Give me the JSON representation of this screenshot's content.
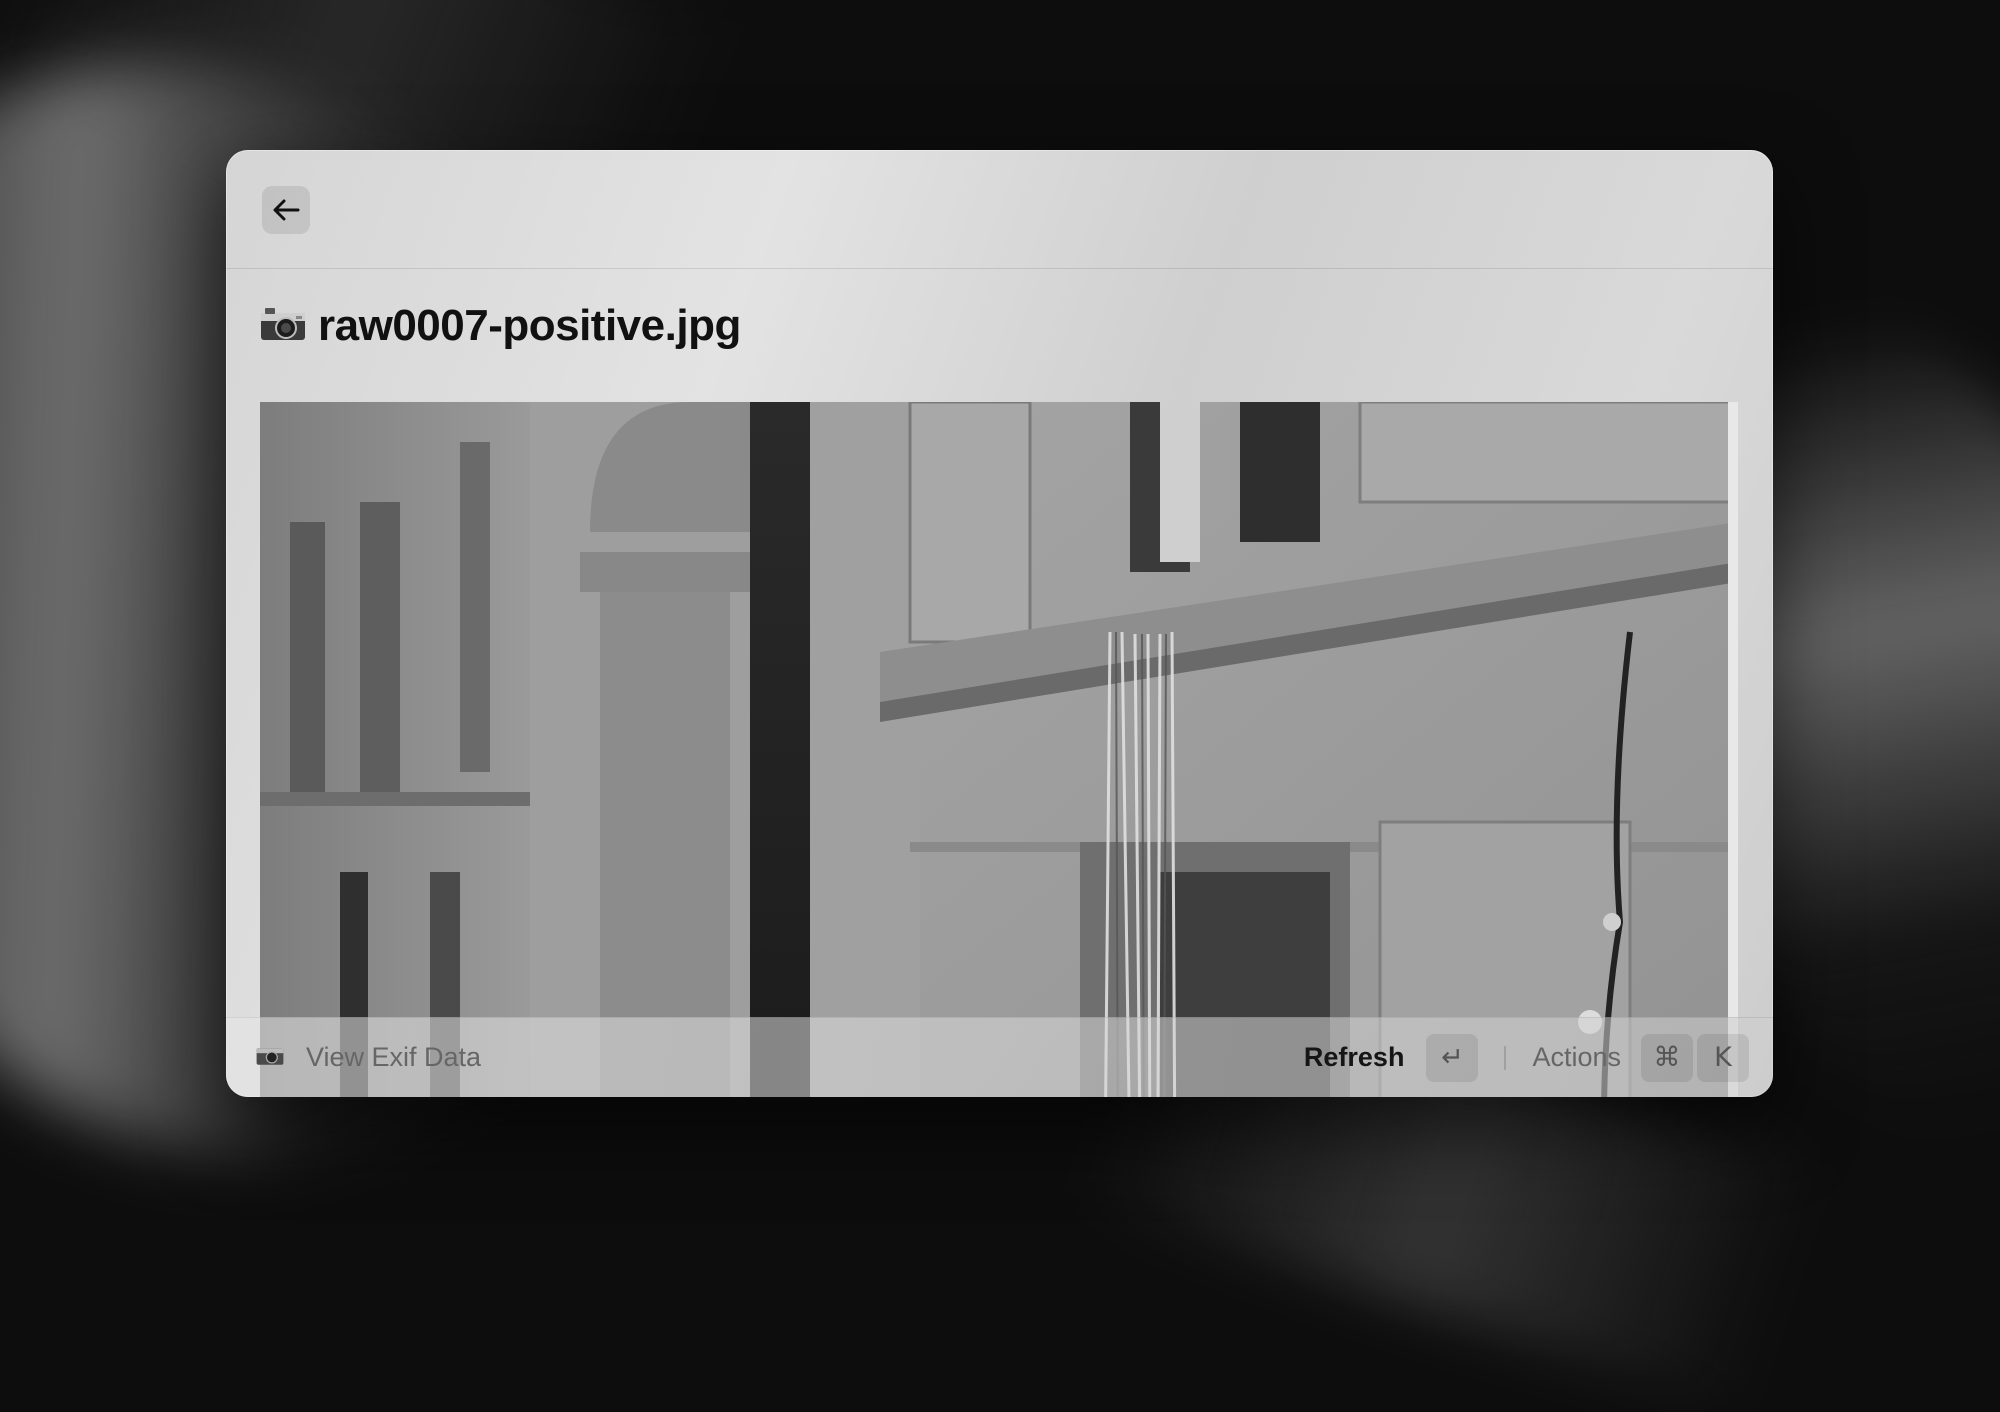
{
  "window": {
    "back_button_label": "←",
    "title_icon": "camera-icon",
    "title": "raw0007-positive.jpg"
  },
  "preview": {
    "image_description_icon": "photo-preview"
  },
  "action_bar": {
    "action_icon": "camera-icon",
    "action_label": "View Exif Data",
    "primary_action_label": "Refresh",
    "primary_shortcut_key": "↵",
    "secondary_action_label": "Actions",
    "secondary_shortcut_keys": [
      "⌘",
      "K"
    ]
  },
  "colors": {
    "window_bg": "#d9d9d9",
    "page_bg": "#0d0d0d",
    "text_primary": "#111111",
    "text_secondary": "#666666"
  }
}
